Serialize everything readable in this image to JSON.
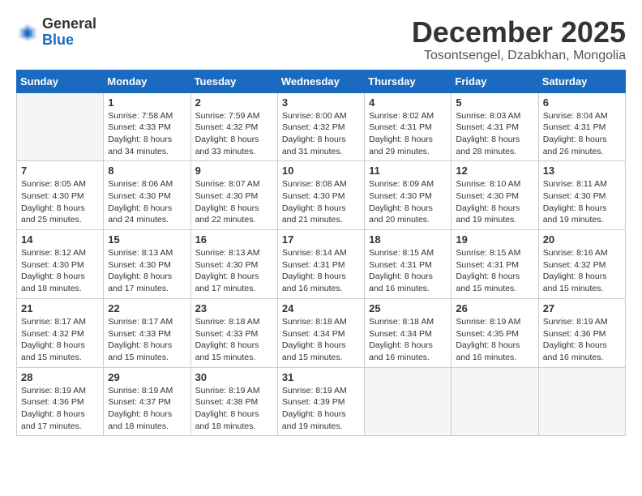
{
  "header": {
    "logo_general": "General",
    "logo_blue": "Blue",
    "month_title": "December 2025",
    "location": "Tosontsengel, Dzabkhan, Mongolia"
  },
  "days_of_week": [
    "Sunday",
    "Monday",
    "Tuesday",
    "Wednesday",
    "Thursday",
    "Friday",
    "Saturday"
  ],
  "weeks": [
    [
      {
        "day": "",
        "empty": true
      },
      {
        "day": "1",
        "sunrise": "7:58 AM",
        "sunset": "4:33 PM",
        "daylight": "8 hours and 34 minutes."
      },
      {
        "day": "2",
        "sunrise": "7:59 AM",
        "sunset": "4:32 PM",
        "daylight": "8 hours and 33 minutes."
      },
      {
        "day": "3",
        "sunrise": "8:00 AM",
        "sunset": "4:32 PM",
        "daylight": "8 hours and 31 minutes."
      },
      {
        "day": "4",
        "sunrise": "8:02 AM",
        "sunset": "4:31 PM",
        "daylight": "8 hours and 29 minutes."
      },
      {
        "day": "5",
        "sunrise": "8:03 AM",
        "sunset": "4:31 PM",
        "daylight": "8 hours and 28 minutes."
      },
      {
        "day": "6",
        "sunrise": "8:04 AM",
        "sunset": "4:31 PM",
        "daylight": "8 hours and 26 minutes."
      }
    ],
    [
      {
        "day": "7",
        "sunrise": "8:05 AM",
        "sunset": "4:30 PM",
        "daylight": "8 hours and 25 minutes."
      },
      {
        "day": "8",
        "sunrise": "8:06 AM",
        "sunset": "4:30 PM",
        "daylight": "8 hours and 24 minutes."
      },
      {
        "day": "9",
        "sunrise": "8:07 AM",
        "sunset": "4:30 PM",
        "daylight": "8 hours and 22 minutes."
      },
      {
        "day": "10",
        "sunrise": "8:08 AM",
        "sunset": "4:30 PM",
        "daylight": "8 hours and 21 minutes."
      },
      {
        "day": "11",
        "sunrise": "8:09 AM",
        "sunset": "4:30 PM",
        "daylight": "8 hours and 20 minutes."
      },
      {
        "day": "12",
        "sunrise": "8:10 AM",
        "sunset": "4:30 PM",
        "daylight": "8 hours and 19 minutes."
      },
      {
        "day": "13",
        "sunrise": "8:11 AM",
        "sunset": "4:30 PM",
        "daylight": "8 hours and 19 minutes."
      }
    ],
    [
      {
        "day": "14",
        "sunrise": "8:12 AM",
        "sunset": "4:30 PM",
        "daylight": "8 hours and 18 minutes."
      },
      {
        "day": "15",
        "sunrise": "8:13 AM",
        "sunset": "4:30 PM",
        "daylight": "8 hours and 17 minutes."
      },
      {
        "day": "16",
        "sunrise": "8:13 AM",
        "sunset": "4:30 PM",
        "daylight": "8 hours and 17 minutes."
      },
      {
        "day": "17",
        "sunrise": "8:14 AM",
        "sunset": "4:31 PM",
        "daylight": "8 hours and 16 minutes."
      },
      {
        "day": "18",
        "sunrise": "8:15 AM",
        "sunset": "4:31 PM",
        "daylight": "8 hours and 16 minutes."
      },
      {
        "day": "19",
        "sunrise": "8:15 AM",
        "sunset": "4:31 PM",
        "daylight": "8 hours and 15 minutes."
      },
      {
        "day": "20",
        "sunrise": "8:16 AM",
        "sunset": "4:32 PM",
        "daylight": "8 hours and 15 minutes."
      }
    ],
    [
      {
        "day": "21",
        "sunrise": "8:17 AM",
        "sunset": "4:32 PM",
        "daylight": "8 hours and 15 minutes."
      },
      {
        "day": "22",
        "sunrise": "8:17 AM",
        "sunset": "4:33 PM",
        "daylight": "8 hours and 15 minutes."
      },
      {
        "day": "23",
        "sunrise": "8:18 AM",
        "sunset": "4:33 PM",
        "daylight": "8 hours and 15 minutes."
      },
      {
        "day": "24",
        "sunrise": "8:18 AM",
        "sunset": "4:34 PM",
        "daylight": "8 hours and 15 minutes."
      },
      {
        "day": "25",
        "sunrise": "8:18 AM",
        "sunset": "4:34 PM",
        "daylight": "8 hours and 16 minutes."
      },
      {
        "day": "26",
        "sunrise": "8:19 AM",
        "sunset": "4:35 PM",
        "daylight": "8 hours and 16 minutes."
      },
      {
        "day": "27",
        "sunrise": "8:19 AM",
        "sunset": "4:36 PM",
        "daylight": "8 hours and 16 minutes."
      }
    ],
    [
      {
        "day": "28",
        "sunrise": "8:19 AM",
        "sunset": "4:36 PM",
        "daylight": "8 hours and 17 minutes."
      },
      {
        "day": "29",
        "sunrise": "8:19 AM",
        "sunset": "4:37 PM",
        "daylight": "8 hours and 18 minutes."
      },
      {
        "day": "30",
        "sunrise": "8:19 AM",
        "sunset": "4:38 PM",
        "daylight": "8 hours and 18 minutes."
      },
      {
        "day": "31",
        "sunrise": "8:19 AM",
        "sunset": "4:39 PM",
        "daylight": "8 hours and 19 minutes."
      },
      {
        "day": "",
        "empty": true
      },
      {
        "day": "",
        "empty": true
      },
      {
        "day": "",
        "empty": true
      }
    ]
  ]
}
